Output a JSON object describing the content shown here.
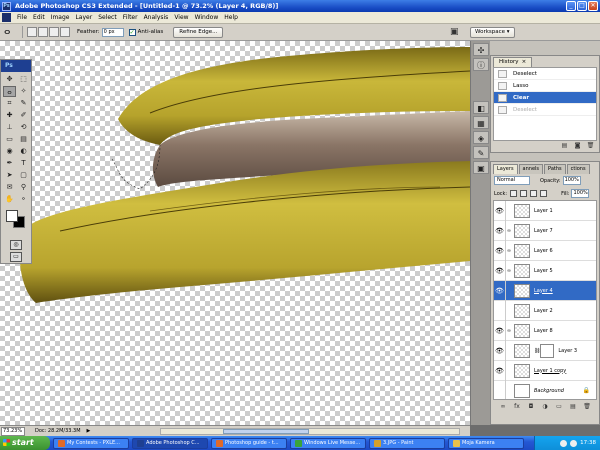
{
  "window": {
    "title": "Adobe Photoshop CS3 Extended - [Untitled-1 @ 73.2% (Layer 4, RGB/8)]",
    "app_icon": "Ps",
    "buttons": [
      "_",
      "□",
      "✕"
    ]
  },
  "menu": [
    "File",
    "Edit",
    "Image",
    "Layer",
    "Select",
    "Filter",
    "Analysis",
    "View",
    "Window",
    "Help"
  ],
  "options": {
    "feather_label": "Feather:",
    "feather_value": "0 px",
    "antialias_label": "Anti-alias",
    "antialias_checked": "✓",
    "refine_label": "Refine Edge...",
    "workspace_label": "Workspace ▾"
  },
  "toolbox": {
    "logo": "Ps"
  },
  "history": {
    "tab": "History",
    "close": "×",
    "items": [
      {
        "label": "Deselect",
        "state": "normal"
      },
      {
        "label": "Lasso",
        "state": "normal"
      },
      {
        "label": "Clear",
        "state": "active"
      },
      {
        "label": "Deselect",
        "state": "dim"
      }
    ]
  },
  "layers_panel": {
    "tabs": [
      "Layers",
      "annels",
      "Paths",
      "ctions"
    ],
    "blend_mode": "Normal",
    "opacity_label": "Opacity:",
    "opacity_value": "100%",
    "lock_label": "Lock:",
    "fill_label": "Fill:",
    "fill_value": "100%",
    "layers": [
      {
        "name": "Layer 1",
        "visible": true,
        "style": "normal"
      },
      {
        "name": "Layer 7",
        "visible": true,
        "style": "normal"
      },
      {
        "name": "Layer 6",
        "visible": true,
        "style": "normal"
      },
      {
        "name": "Layer 5",
        "visible": true,
        "style": "normal"
      },
      {
        "name": "Layer 4",
        "visible": true,
        "style": "active"
      },
      {
        "name": "Layer 2",
        "visible": false,
        "style": "normal"
      },
      {
        "name": "Layer 8",
        "visible": true,
        "style": "normal"
      },
      {
        "name": "Layer 3",
        "visible": true,
        "style": "mask"
      },
      {
        "name": "Layer 1 copy",
        "visible": true,
        "style": "underline"
      },
      {
        "name": "Background",
        "visible": false,
        "style": "background"
      }
    ],
    "bottom_icons": [
      "link-icon",
      "fx-icon",
      "mask-icon",
      "adjustment-icon",
      "folder-icon",
      "new-layer-icon",
      "trash-icon"
    ]
  },
  "status": {
    "zoom": "73.23%",
    "doc": "Doc: 28.2M/33.3M"
  },
  "taskbar": {
    "start": "start",
    "tasks": [
      {
        "label": "My Contests - PXLE...",
        "color": "#e06a2a"
      },
      {
        "label": "Adobe Photoshop C...",
        "color": "#1e3f91"
      },
      {
        "label": "Photoshop guide - t...",
        "color": "#e06a2a"
      },
      {
        "label": "Windows Live Messe...",
        "color": "#3aa43a"
      },
      {
        "label": "3.JPG - Paint",
        "color": "#d4a02a"
      },
      {
        "label": "Moja Kamera",
        "color": "#e8c04a"
      }
    ],
    "clock": "17:38"
  },
  "colors": {
    "accent": "#316ac5",
    "banana_yellow": "#c9b73a",
    "banana_dark": "#5a4e10",
    "inner_flesh": "#8a7566"
  }
}
